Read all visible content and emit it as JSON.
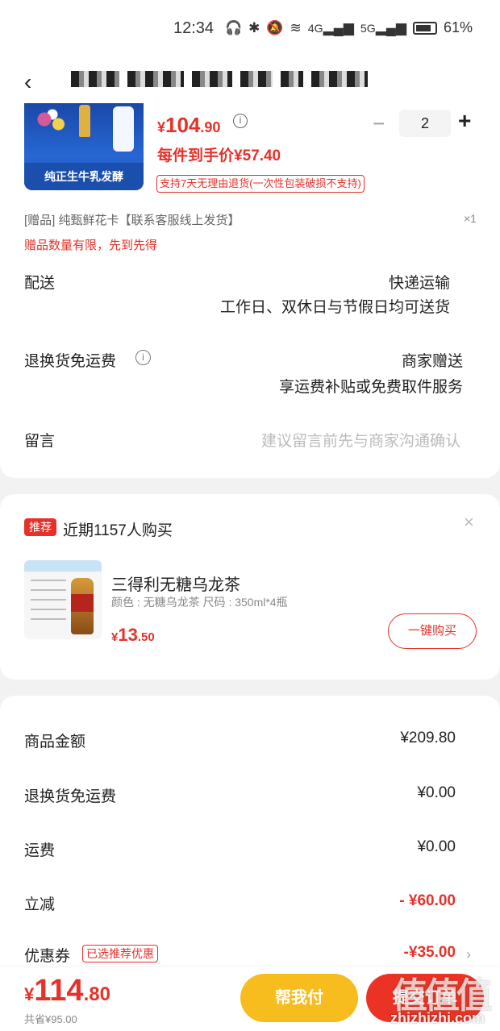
{
  "status_bar": {
    "time": "12:34",
    "network_labels": [
      "4G",
      "5G"
    ],
    "battery_pct": "61%"
  },
  "product": {
    "image_caption": "纯正生牛乳发酵",
    "price_yen": "¥",
    "price_int": "104",
    "price_dec": ".90",
    "quantity": "2",
    "unit_price": "每件到手价¥57.40",
    "return_tag": "支持7天无理由退货(一次性包装破损不支持)",
    "gift_line": "[赠品]  纯甄鲜花卡【联系客服线上发货】",
    "gift_count": "×1",
    "gift_limit": "赠品数量有限，先到先得"
  },
  "delivery": {
    "label": "配送",
    "method": "快递运输",
    "schedule": "工作日、双休日与节假日均可送货"
  },
  "return_fee": {
    "label": "退换货免运费",
    "provider": "商家赠送",
    "detail": "享运费补贴或免费取件服务"
  },
  "message": {
    "label": "留言",
    "placeholder": "建议留言前先与商家沟通确认"
  },
  "recommend": {
    "badge": "推荐",
    "title": "近期1157人购买",
    "close": "×",
    "name": "三得利无糖乌龙茶",
    "spec": "颜色 : 无糖乌龙茶    尺码 : 350ml*4瓶",
    "price_yen": "¥",
    "price_int": "13",
    "price_dec": ".50",
    "buy_label": "一键购买"
  },
  "summary": {
    "items": [
      {
        "label": "商品金额",
        "value": "¥209.80"
      },
      {
        "label": "退换货免运费",
        "value": "¥0.00"
      },
      {
        "label": "运费",
        "value": "¥0.00"
      },
      {
        "label": "立减",
        "value": "- ¥60.00"
      },
      {
        "label": "优惠券",
        "value": "-¥35.00"
      }
    ],
    "coupon_tag": "已选推荐优惠",
    "chevron": "›"
  },
  "bottom": {
    "total_yen": "¥",
    "total_int": "114",
    "total_dec": ".80",
    "total_save": "共省¥95.00",
    "help_pay": "帮我付",
    "submit": "提交订单"
  },
  "watermark": {
    "logo": "值值值",
    "url": "zhizhizhi.com"
  },
  "colors": {
    "accent": "#e4322b",
    "help_button": "#f7bd1f",
    "submit_button": "#ea3325"
  }
}
